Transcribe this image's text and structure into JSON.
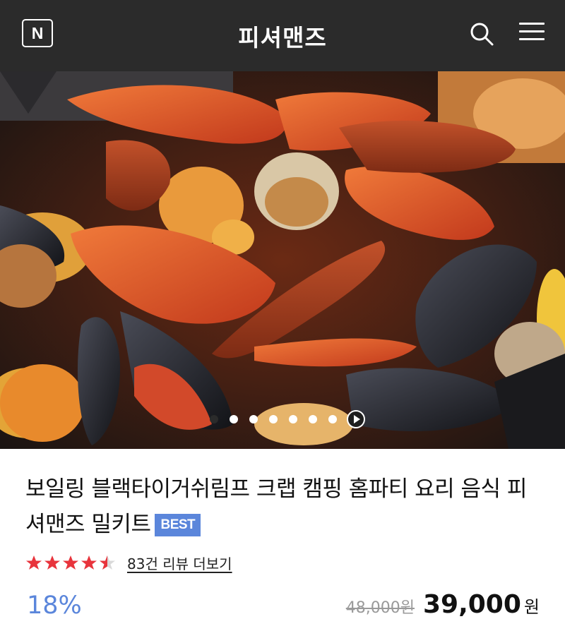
{
  "header": {
    "logo_letter": "N",
    "brand": "피셔맨즈",
    "search_icon": "search-icon",
    "menu_icon": "hamburger-menu-icon",
    "background_color": "#2b2b2b"
  },
  "carousel": {
    "total_slides": 7,
    "active_index": 0,
    "play_icon": "play-icon"
  },
  "product": {
    "title": "보일링 블랙타이거쉬림프 크랩 캠핑 홈파티 요리 음식 피셔맨즈 밀키트",
    "badge": "BEST",
    "rating": 4.5,
    "rating_max": 5,
    "review_link": "83건 리뷰 더보기",
    "discount": "18%",
    "original_price": "48,000원",
    "sale_price": "39,000",
    "currency": "원",
    "accent_color": "#5b86db",
    "star_color": "#e8343c"
  }
}
